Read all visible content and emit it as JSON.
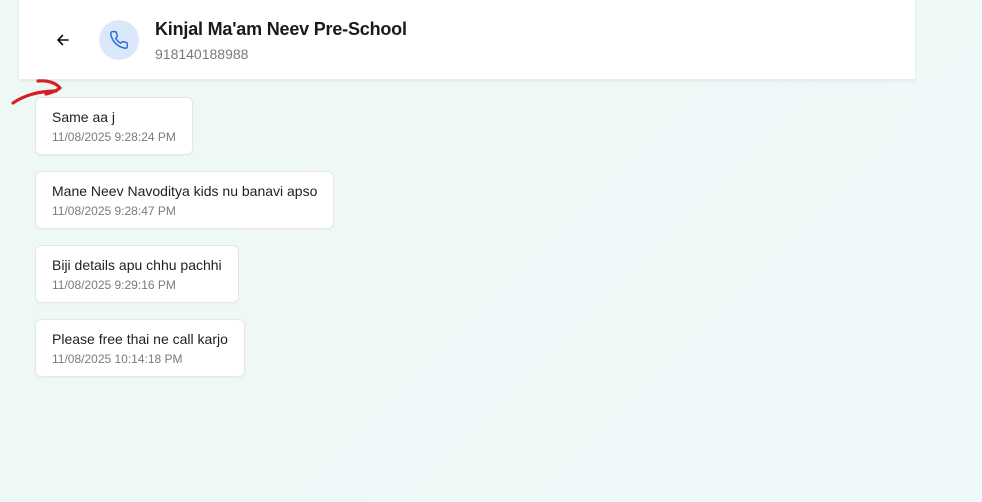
{
  "header": {
    "contact_name": "Kinjal Ma'am Neev Pre-School",
    "contact_phone": "918140188988",
    "back_icon": "arrow-left-icon",
    "avatar_icon": "phone-icon"
  },
  "colors": {
    "avatar_bg": "#dbe8fb",
    "phone_icon": "#2f6fd6",
    "annotation": "#d62020"
  },
  "messages": [
    {
      "text": "Same aa j",
      "time": "11/08/2025 9:28:24 PM"
    },
    {
      "text": "Mane Neev Navoditya kids nu banavi apso",
      "time": "11/08/2025 9:28:47 PM"
    },
    {
      "text": "Biji details apu chhu pachhi",
      "time": "11/08/2025 9:29:16 PM"
    },
    {
      "text": "Please free thai ne call karjo",
      "time": "11/08/2025 10:14:18 PM"
    }
  ]
}
